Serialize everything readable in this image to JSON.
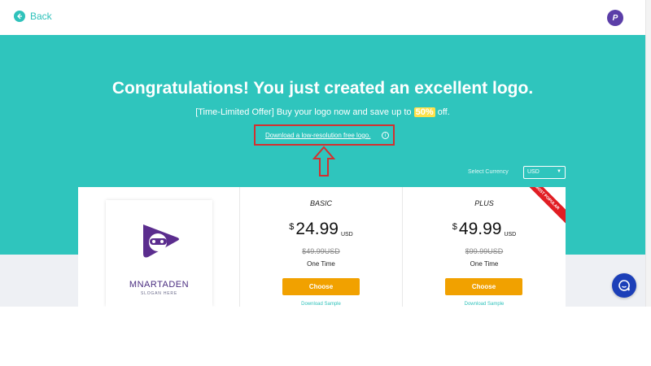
{
  "header": {
    "back_label": "Back",
    "avatar_letter": "P"
  },
  "hero": {
    "headline": "Congratulations! You just created an excellent logo.",
    "offer_prefix": "[Time-Limited Offer] Buy your logo now and save up to ",
    "offer_pct": "50%",
    "offer_suffix": " off.",
    "download_link": "Download a low-resolution free logo.",
    "info_glyph": "i"
  },
  "currency": {
    "label": "Select Currency",
    "selected": "USD"
  },
  "logo_preview": {
    "brand": "MNARTADEN",
    "slogan": "SLOGAN HERE"
  },
  "plans": [
    {
      "name": "BASIC",
      "currency_symbol": "$",
      "price": "24.99",
      "code": "USD",
      "old_price": "$49.99USD",
      "term": "One Time",
      "cta": "Choose",
      "sample": "Download Sample"
    },
    {
      "name": "PLUS",
      "currency_symbol": "$",
      "price": "49.99",
      "code": "USD",
      "old_price": "$99.99USD",
      "term": "One Time",
      "cta": "Choose",
      "sample": "Download Sample",
      "ribbon": "MOST POPULAR"
    }
  ],
  "colors": {
    "accent": "#2fc5bd",
    "cta": "#f1a100",
    "ribbon": "#e11d23",
    "annotation": "#d3302f",
    "chat": "#1c3fb8"
  }
}
